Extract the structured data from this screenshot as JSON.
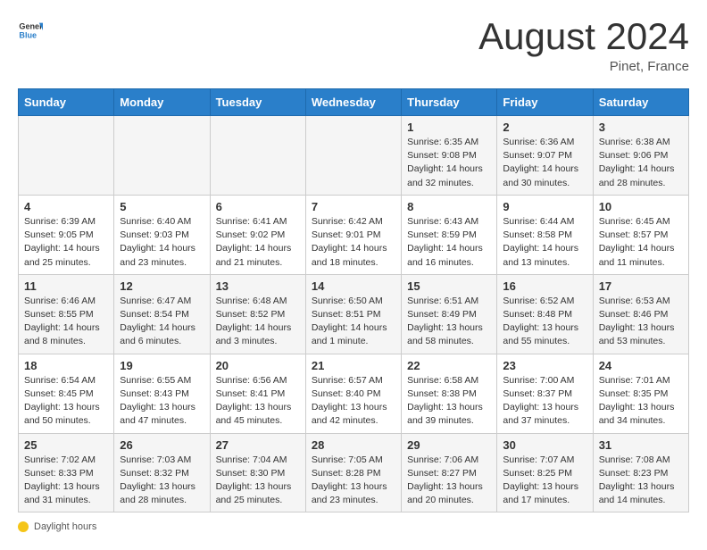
{
  "header": {
    "logo_general": "General",
    "logo_blue": "Blue",
    "month_title": "August 2024",
    "location": "Pinet, France"
  },
  "days_of_week": [
    "Sunday",
    "Monday",
    "Tuesday",
    "Wednesday",
    "Thursday",
    "Friday",
    "Saturday"
  ],
  "weeks": [
    [
      {
        "day": "",
        "info": ""
      },
      {
        "day": "",
        "info": ""
      },
      {
        "day": "",
        "info": ""
      },
      {
        "day": "",
        "info": ""
      },
      {
        "day": "1",
        "info": "Sunrise: 6:35 AM\nSunset: 9:08 PM\nDaylight: 14 hours and 32 minutes."
      },
      {
        "day": "2",
        "info": "Sunrise: 6:36 AM\nSunset: 9:07 PM\nDaylight: 14 hours and 30 minutes."
      },
      {
        "day": "3",
        "info": "Sunrise: 6:38 AM\nSunset: 9:06 PM\nDaylight: 14 hours and 28 minutes."
      }
    ],
    [
      {
        "day": "4",
        "info": "Sunrise: 6:39 AM\nSunset: 9:05 PM\nDaylight: 14 hours and 25 minutes."
      },
      {
        "day": "5",
        "info": "Sunrise: 6:40 AM\nSunset: 9:03 PM\nDaylight: 14 hours and 23 minutes."
      },
      {
        "day": "6",
        "info": "Sunrise: 6:41 AM\nSunset: 9:02 PM\nDaylight: 14 hours and 21 minutes."
      },
      {
        "day": "7",
        "info": "Sunrise: 6:42 AM\nSunset: 9:01 PM\nDaylight: 14 hours and 18 minutes."
      },
      {
        "day": "8",
        "info": "Sunrise: 6:43 AM\nSunset: 8:59 PM\nDaylight: 14 hours and 16 minutes."
      },
      {
        "day": "9",
        "info": "Sunrise: 6:44 AM\nSunset: 8:58 PM\nDaylight: 14 hours and 13 minutes."
      },
      {
        "day": "10",
        "info": "Sunrise: 6:45 AM\nSunset: 8:57 PM\nDaylight: 14 hours and 11 minutes."
      }
    ],
    [
      {
        "day": "11",
        "info": "Sunrise: 6:46 AM\nSunset: 8:55 PM\nDaylight: 14 hours and 8 minutes."
      },
      {
        "day": "12",
        "info": "Sunrise: 6:47 AM\nSunset: 8:54 PM\nDaylight: 14 hours and 6 minutes."
      },
      {
        "day": "13",
        "info": "Sunrise: 6:48 AM\nSunset: 8:52 PM\nDaylight: 14 hours and 3 minutes."
      },
      {
        "day": "14",
        "info": "Sunrise: 6:50 AM\nSunset: 8:51 PM\nDaylight: 14 hours and 1 minute."
      },
      {
        "day": "15",
        "info": "Sunrise: 6:51 AM\nSunset: 8:49 PM\nDaylight: 13 hours and 58 minutes."
      },
      {
        "day": "16",
        "info": "Sunrise: 6:52 AM\nSunset: 8:48 PM\nDaylight: 13 hours and 55 minutes."
      },
      {
        "day": "17",
        "info": "Sunrise: 6:53 AM\nSunset: 8:46 PM\nDaylight: 13 hours and 53 minutes."
      }
    ],
    [
      {
        "day": "18",
        "info": "Sunrise: 6:54 AM\nSunset: 8:45 PM\nDaylight: 13 hours and 50 minutes."
      },
      {
        "day": "19",
        "info": "Sunrise: 6:55 AM\nSunset: 8:43 PM\nDaylight: 13 hours and 47 minutes."
      },
      {
        "day": "20",
        "info": "Sunrise: 6:56 AM\nSunset: 8:41 PM\nDaylight: 13 hours and 45 minutes."
      },
      {
        "day": "21",
        "info": "Sunrise: 6:57 AM\nSunset: 8:40 PM\nDaylight: 13 hours and 42 minutes."
      },
      {
        "day": "22",
        "info": "Sunrise: 6:58 AM\nSunset: 8:38 PM\nDaylight: 13 hours and 39 minutes."
      },
      {
        "day": "23",
        "info": "Sunrise: 7:00 AM\nSunset: 8:37 PM\nDaylight: 13 hours and 37 minutes."
      },
      {
        "day": "24",
        "info": "Sunrise: 7:01 AM\nSunset: 8:35 PM\nDaylight: 13 hours and 34 minutes."
      }
    ],
    [
      {
        "day": "25",
        "info": "Sunrise: 7:02 AM\nSunset: 8:33 PM\nDaylight: 13 hours and 31 minutes."
      },
      {
        "day": "26",
        "info": "Sunrise: 7:03 AM\nSunset: 8:32 PM\nDaylight: 13 hours and 28 minutes."
      },
      {
        "day": "27",
        "info": "Sunrise: 7:04 AM\nSunset: 8:30 PM\nDaylight: 13 hours and 25 minutes."
      },
      {
        "day": "28",
        "info": "Sunrise: 7:05 AM\nSunset: 8:28 PM\nDaylight: 13 hours and 23 minutes."
      },
      {
        "day": "29",
        "info": "Sunrise: 7:06 AM\nSunset: 8:27 PM\nDaylight: 13 hours and 20 minutes."
      },
      {
        "day": "30",
        "info": "Sunrise: 7:07 AM\nSunset: 8:25 PM\nDaylight: 13 hours and 17 minutes."
      },
      {
        "day": "31",
        "info": "Sunrise: 7:08 AM\nSunset: 8:23 PM\nDaylight: 13 hours and 14 minutes."
      }
    ]
  ],
  "footer": {
    "label": "Daylight hours"
  }
}
